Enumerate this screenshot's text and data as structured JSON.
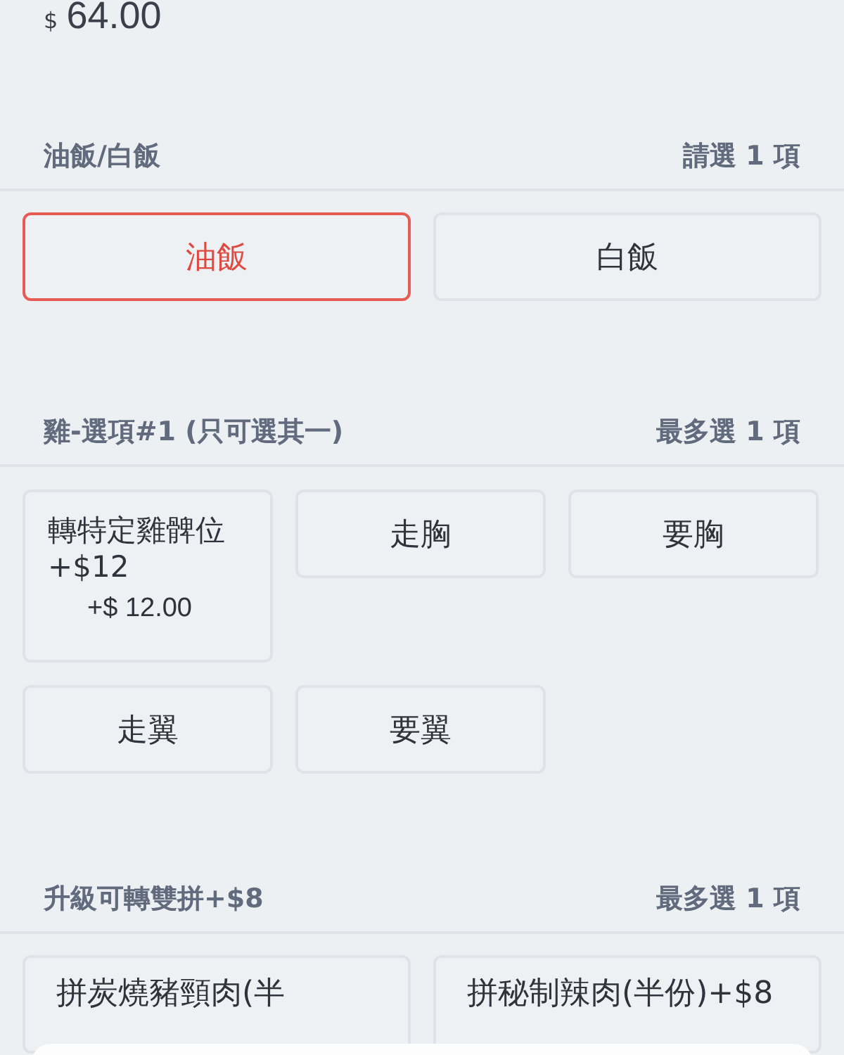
{
  "price": {
    "currency": "$",
    "amount": "64.00"
  },
  "sections": [
    {
      "title": "油飯/白飯",
      "rule": "請選 1 項",
      "kind": "two-column",
      "options": [
        {
          "label": "油飯",
          "selected": true
        },
        {
          "label": "白飯",
          "selected": false
        }
      ]
    },
    {
      "title": "雞-選項#1 (只可選其一)",
      "rule": "最多選 1 項",
      "kind": "three-column",
      "options": [
        {
          "label": "轉特定雞髀位+$12",
          "price": "+$ 12.00",
          "selected": false
        },
        {
          "label": "走胸",
          "selected": false
        },
        {
          "label": "要胸",
          "selected": false
        },
        {
          "label": "走翼",
          "selected": false
        },
        {
          "label": "要翼",
          "selected": false
        }
      ]
    },
    {
      "title": "升級可轉雙拼+$8",
      "rule": "最多選 1 項",
      "kind": "two-column",
      "options": [
        {
          "label": "拼炭燒豬頸肉(半",
          "selected": false
        },
        {
          "label": "拼秘制辣肉(半份)+$8",
          "selected": false
        }
      ]
    }
  ]
}
